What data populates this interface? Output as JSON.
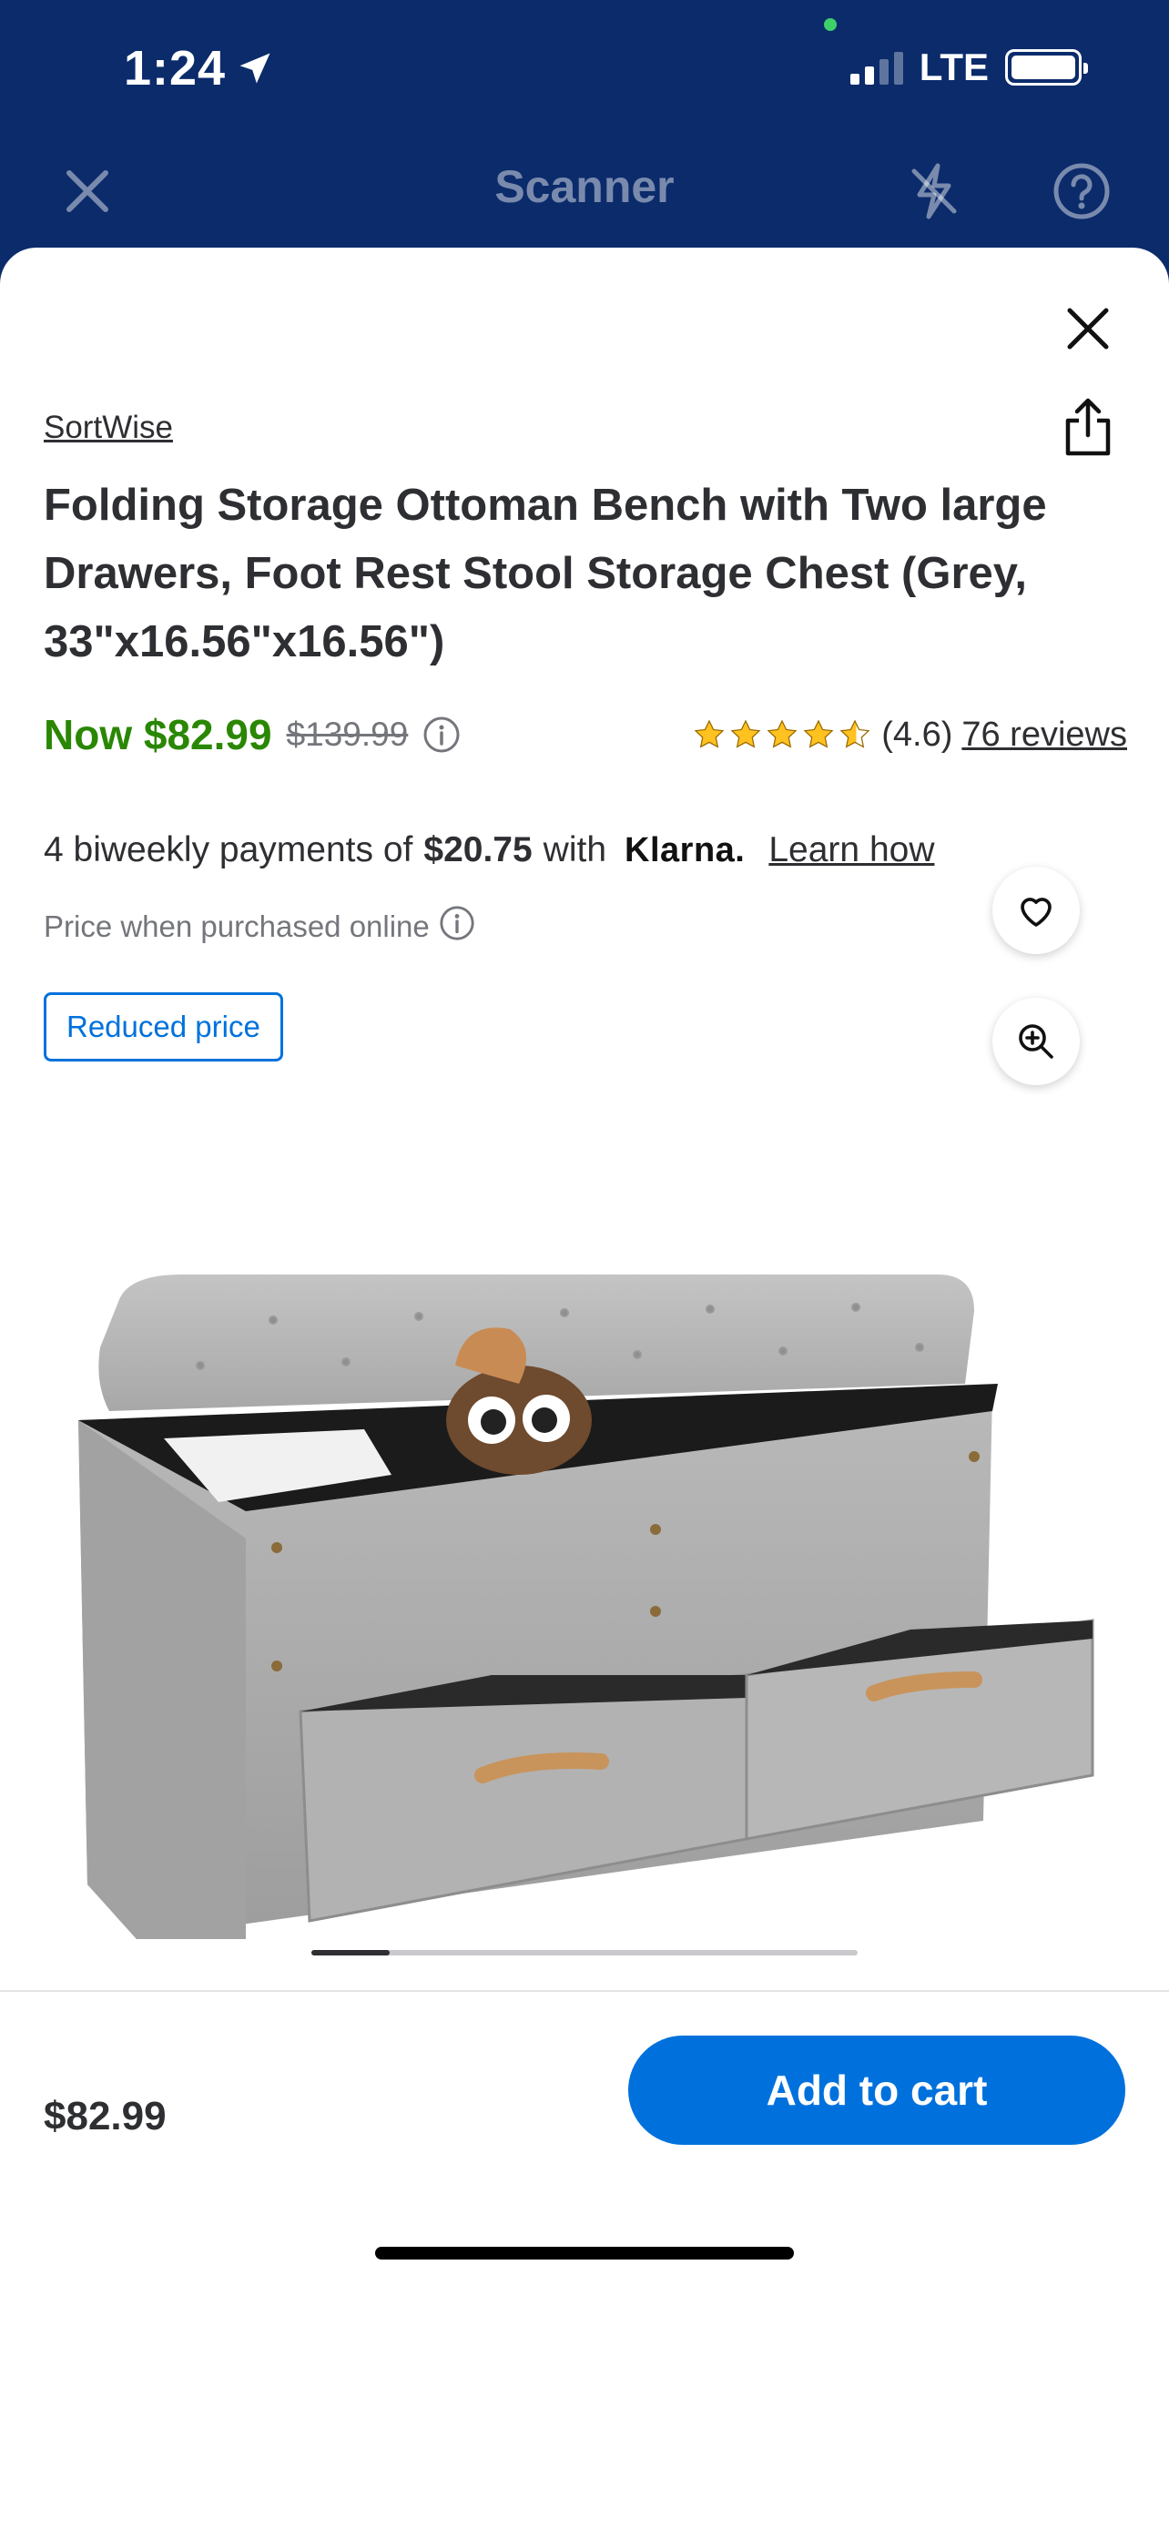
{
  "status_bar": {
    "time": "1:24",
    "network": "LTE"
  },
  "header": {
    "title": "Scanner"
  },
  "product": {
    "brand": "SortWise",
    "title": "Folding Storage Ottoman Bench with Two large Drawers, Foot Rest Stool Storage Chest (Grey, 33\"x16.56\"x16.56\")",
    "price_now": "Now $82.99",
    "price_was": "$139.99",
    "rating_value": 4.6,
    "rating_text": "(4.6)",
    "reviews_label": "76 reviews",
    "klarna_prefix": "4 biweekly payments of",
    "klarna_amount": "$20.75",
    "klarna_with": "with",
    "klarna_brand": "Klarna.",
    "learn_how": "Learn how",
    "online_note": "Price when purchased online",
    "badge": "Reduced price"
  },
  "carousel": {
    "current": 1,
    "total": 7
  },
  "footer": {
    "price": "$82.99",
    "add_to_cart": "Add to cart"
  },
  "colors": {
    "brand_blue": "#0071dc",
    "price_green": "#2a8703",
    "header_navy": "#0b2b6b",
    "star": "#ffc220"
  },
  "icons": [
    "location-arrow-icon",
    "close-icon",
    "flash-off-icon",
    "help-icon",
    "share-icon",
    "info-icon",
    "star-icon",
    "heart-icon",
    "zoom-in-icon"
  ]
}
